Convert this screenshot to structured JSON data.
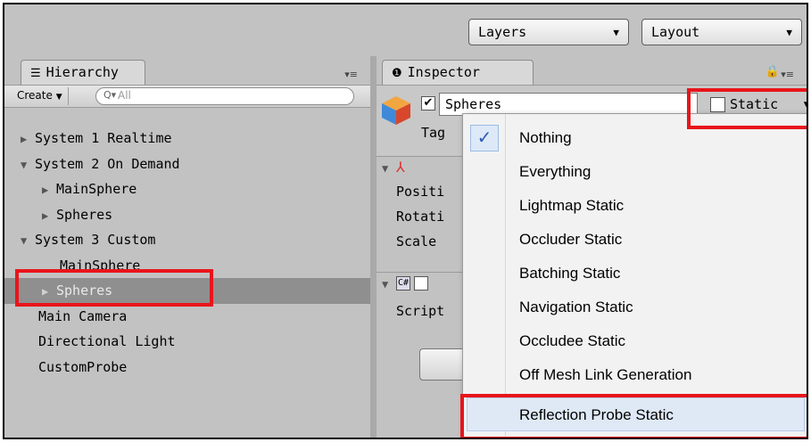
{
  "toolbar": {
    "layers_label": "Layers",
    "layout_label": "Layout"
  },
  "hierarchy": {
    "tab_label": "Hierarchy",
    "create_label": "Create",
    "search_placeholder": "All",
    "items": [
      {
        "label": "System 1 Realtime",
        "arrow": "▶"
      },
      {
        "label": "System 2 On Demand",
        "arrow": "▼"
      },
      {
        "label": "MainSphere",
        "arrow": "▶"
      },
      {
        "label": "Spheres",
        "arrow": "▶"
      },
      {
        "label": "System 3 Custom",
        "arrow": "▼"
      },
      {
        "label": "MainSphere",
        "arrow": ""
      },
      {
        "label": "Spheres",
        "arrow": "▶"
      },
      {
        "label": "Main Camera",
        "arrow": ""
      },
      {
        "label": "Directional Light",
        "arrow": ""
      },
      {
        "label": "CustomProbe",
        "arrow": ""
      }
    ]
  },
  "inspector": {
    "tab_label": "Inspector",
    "object_name": "Spheres",
    "static_label": "Static",
    "tag_label": "Tag",
    "transform": {
      "position_label": "Positi",
      "rotation_label": "Rotati",
      "scale_label": "Scale"
    },
    "script_label": "Script"
  },
  "static_menu": {
    "items": [
      {
        "label": "Nothing",
        "checked": true
      },
      {
        "label": "Everything",
        "checked": false
      },
      {
        "label": "Lightmap Static",
        "checked": false
      },
      {
        "label": "Occluder Static",
        "checked": false
      },
      {
        "label": "Batching Static",
        "checked": false
      },
      {
        "label": "Navigation Static",
        "checked": false
      },
      {
        "label": "Occludee Static",
        "checked": false
      },
      {
        "label": "Off Mesh Link Generation",
        "checked": false
      },
      {
        "label": "Reflection Probe Static",
        "checked": false
      }
    ],
    "check_glyph": "✓"
  },
  "colors": {
    "annotation": "#e8151b",
    "selection": "#8f8f8f",
    "panel_bg": "#c2c2c2"
  }
}
